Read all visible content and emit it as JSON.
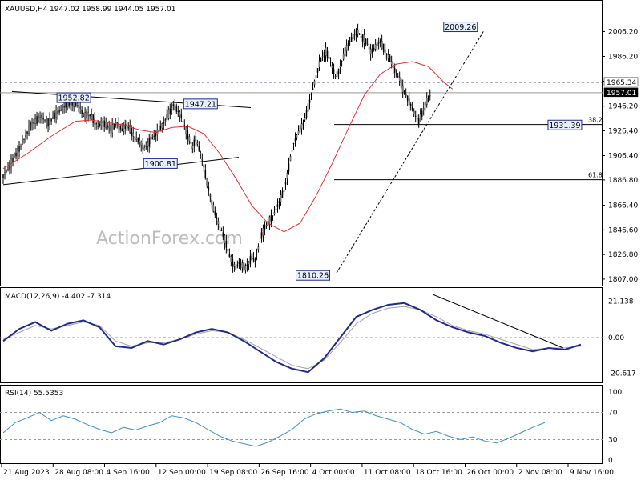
{
  "header": {
    "symbol": "XAUUSD,H4",
    "ohlc": "1947.02 1958.99 1944.05 1957.01"
  },
  "watermark": "ActionForex.com",
  "colors": {
    "candle": "#000000",
    "ma": "#e03030",
    "macd": "#1f2a8c",
    "signal": "#a0a0a0",
    "rsi": "#3a8fd0",
    "label_bg": "#e8f0ff",
    "label_border": "#1f2a8c",
    "current_price_bg": "#000000"
  },
  "chart_data": [
    {
      "type": "candlestick",
      "panel": "price",
      "title": "XAUUSD,H4",
      "ylim": [
        1805,
        2020
      ],
      "y_ticks": [
        2006.2,
        1986.2,
        1966.2,
        1946.2,
        1926.4,
        1906.4,
        1886.8,
        1866.4,
        1846.6,
        1826.8,
        1807.0
      ],
      "y_tick_labels": [
        "2006.20",
        "1986.20",
        "",
        "1946.20",
        "1926.40",
        "1906.40",
        "1886.80",
        "1866.40",
        "1846.60",
        "1826.80",
        "1807.00"
      ],
      "x_labels": [
        "21 Aug 2023",
        "28 Aug 08:00",
        "4 Sep 16:00",
        "12 Sep 00:00",
        "19 Sep 08:00",
        "26 Sep 16:00",
        "4 Oct 00:00",
        "11 Oct 08:00",
        "18 Oct 16:00",
        "26 Oct 00:00",
        "2 Nov 08:00",
        "9 Nov 16:00"
      ],
      "close_path": [
        [
          0,
          1890
        ],
        [
          8,
          1898
        ],
        [
          14,
          1905
        ],
        [
          22,
          1914
        ],
        [
          28,
          1922
        ],
        [
          34,
          1930
        ],
        [
          40,
          1934
        ],
        [
          48,
          1938
        ],
        [
          54,
          1932
        ],
        [
          60,
          1935
        ],
        [
          66,
          1940
        ],
        [
          72,
          1943
        ],
        [
          78,
          1947
        ],
        [
          84,
          1948
        ],
        [
          90,
          1949
        ],
        [
          96,
          1945
        ],
        [
          100,
          1938
        ],
        [
          106,
          1940
        ],
        [
          112,
          1936
        ],
        [
          118,
          1930
        ],
        [
          124,
          1933
        ],
        [
          130,
          1930
        ],
        [
          136,
          1928
        ],
        [
          142,
          1933
        ],
        [
          148,
          1927
        ],
        [
          154,
          1931
        ],
        [
          158,
          1928
        ],
        [
          164,
          1921
        ],
        [
          170,
          1918
        ],
        [
          176,
          1912
        ],
        [
          182,
          1917
        ],
        [
          188,
          1922
        ],
        [
          196,
          1928
        ],
        [
          202,
          1935
        ],
        [
          208,
          1942
        ],
        [
          212,
          1947
        ],
        [
          216,
          1944
        ],
        [
          222,
          1938
        ],
        [
          226,
          1930
        ],
        [
          232,
          1920
        ],
        [
          236,
          1913
        ],
        [
          240,
          1920
        ],
        [
          246,
          1908
        ],
        [
          250,
          1898
        ],
        [
          254,
          1885
        ],
        [
          258,
          1874
        ],
        [
          262,
          1864
        ],
        [
          266,
          1856
        ],
        [
          270,
          1849
        ],
        [
          274,
          1843
        ],
        [
          278,
          1835
        ],
        [
          282,
          1826
        ],
        [
          286,
          1820
        ],
        [
          290,
          1816
        ],
        [
          294,
          1820
        ],
        [
          298,
          1818
        ],
        [
          302,
          1816
        ],
        [
          306,
          1820
        ],
        [
          310,
          1825
        ],
        [
          314,
          1822
        ],
        [
          318,
          1832
        ],
        [
          322,
          1842
        ],
        [
          326,
          1848
        ],
        [
          330,
          1852
        ],
        [
          334,
          1856
        ],
        [
          338,
          1860
        ],
        [
          342,
          1866
        ],
        [
          346,
          1872
        ],
        [
          350,
          1878
        ],
        [
          354,
          1890
        ],
        [
          358,
          1904
        ],
        [
          362,
          1916
        ],
        [
          366,
          1922
        ],
        [
          370,
          1928
        ],
        [
          374,
          1932
        ],
        [
          378,
          1940
        ],
        [
          382,
          1950
        ],
        [
          386,
          1960
        ],
        [
          390,
          1970
        ],
        [
          394,
          1980
        ],
        [
          398,
          1986
        ],
        [
          402,
          1990
        ],
        [
          406,
          1985
        ],
        [
          410,
          1978
        ],
        [
          414,
          1970
        ],
        [
          418,
          1974
        ],
        [
          422,
          1982
        ],
        [
          426,
          1990
        ],
        [
          430,
          1996
        ],
        [
          434,
          2000
        ],
        [
          438,
          2004
        ],
        [
          442,
          2006
        ],
        [
          446,
          2002
        ],
        [
          450,
          2000
        ],
        [
          454,
          1996
        ],
        [
          458,
          1990
        ],
        [
          462,
          1992
        ],
        [
          466,
          1996
        ],
        [
          470,
          1998
        ],
        [
          474,
          1993
        ],
        [
          478,
          1988
        ],
        [
          482,
          1984
        ],
        [
          486,
          1978
        ],
        [
          490,
          1972
        ],
        [
          494,
          1968
        ],
        [
          498,
          1960
        ],
        [
          502,
          1955
        ],
        [
          506,
          1950
        ],
        [
          510,
          1944
        ],
        [
          514,
          1938
        ],
        [
          518,
          1934
        ],
        [
          522,
          1940
        ],
        [
          526,
          1948
        ],
        [
          530,
          1952
        ],
        [
          534,
          1957
        ]
      ],
      "ma_path": [
        [
          0,
          1896
        ],
        [
          30,
          1908
        ],
        [
          60,
          1922
        ],
        [
          90,
          1934
        ],
        [
          110,
          1935
        ],
        [
          130,
          1933
        ],
        [
          150,
          1931
        ],
        [
          170,
          1927
        ],
        [
          190,
          1925
        ],
        [
          210,
          1929
        ],
        [
          230,
          1930
        ],
        [
          250,
          1924
        ],
        [
          270,
          1908
        ],
        [
          290,
          1888
        ],
        [
          310,
          1866
        ],
        [
          330,
          1852
        ],
        [
          350,
          1845
        ],
        [
          370,
          1852
        ],
        [
          390,
          1874
        ],
        [
          410,
          1900
        ],
        [
          430,
          1928
        ],
        [
          450,
          1955
        ],
        [
          470,
          1972
        ],
        [
          490,
          1980
        ],
        [
          510,
          1982
        ],
        [
          530,
          1978
        ],
        [
          550,
          1965
        ],
        [
          560,
          1960
        ]
      ],
      "annotations": [
        {
          "label": "1952.82"
        },
        {
          "label": "1947.21"
        },
        {
          "label": "1900.81"
        },
        {
          "label": "1810.26"
        },
        {
          "label": "2009.26"
        },
        {
          "label": "1931.39"
        }
      ],
      "price_level_labels": {
        "upper_dashed": "1965.34",
        "current": "1957.01",
        "fib_38": "38.2",
        "fib_61": "61.8"
      }
    },
    {
      "type": "line",
      "panel": "macd",
      "title": "MACD(12,26,9) -4.402 -7.314",
      "ylim": [
        -25,
        25
      ],
      "y_tick_labels": [
        "21.138",
        "0.00",
        "-20.617"
      ],
      "macd_path": [
        [
          0,
          -2
        ],
        [
          20,
          5
        ],
        [
          40,
          9
        ],
        [
          60,
          4
        ],
        [
          80,
          8
        ],
        [
          100,
          10
        ],
        [
          120,
          6
        ],
        [
          140,
          -5
        ],
        [
          160,
          -6
        ],
        [
          180,
          -2
        ],
        [
          200,
          -4
        ],
        [
          220,
          -1
        ],
        [
          240,
          3
        ],
        [
          260,
          5
        ],
        [
          280,
          3
        ],
        [
          300,
          -2
        ],
        [
          320,
          -8
        ],
        [
          340,
          -14
        ],
        [
          360,
          -18
        ],
        [
          380,
          -20
        ],
        [
          400,
          -12
        ],
        [
          420,
          0
        ],
        [
          440,
          12
        ],
        [
          460,
          16
        ],
        [
          480,
          19
        ],
        [
          500,
          20
        ],
        [
          520,
          16
        ],
        [
          540,
          10
        ],
        [
          560,
          6
        ],
        [
          580,
          3
        ],
        [
          600,
          1
        ],
        [
          620,
          -3
        ],
        [
          640,
          -6
        ],
        [
          660,
          -8
        ],
        [
          680,
          -6
        ],
        [
          700,
          -7
        ],
        [
          720,
          -4
        ]
      ],
      "signal_path": [
        [
          0,
          -1
        ],
        [
          20,
          3
        ],
        [
          40,
          7
        ],
        [
          60,
          5
        ],
        [
          80,
          7
        ],
        [
          100,
          9
        ],
        [
          120,
          7
        ],
        [
          140,
          -2
        ],
        [
          160,
          -5
        ],
        [
          180,
          -3
        ],
        [
          200,
          -3
        ],
        [
          220,
          -1
        ],
        [
          240,
          2
        ],
        [
          260,
          4
        ],
        [
          280,
          3
        ],
        [
          300,
          -1
        ],
        [
          320,
          -6
        ],
        [
          340,
          -11
        ],
        [
          360,
          -16
        ],
        [
          380,
          -18
        ],
        [
          400,
          -13
        ],
        [
          420,
          -3
        ],
        [
          440,
          8
        ],
        [
          460,
          14
        ],
        [
          480,
          17
        ],
        [
          500,
          18
        ],
        [
          520,
          16
        ],
        [
          540,
          12
        ],
        [
          560,
          7
        ],
        [
          580,
          4
        ],
        [
          600,
          2
        ],
        [
          620,
          -1
        ],
        [
          640,
          -4
        ],
        [
          660,
          -7
        ],
        [
          680,
          -6
        ],
        [
          700,
          -6
        ],
        [
          720,
          -5
        ]
      ]
    },
    {
      "type": "line",
      "panel": "rsi",
      "title": "RSI(14) 55.5353",
      "ylim": [
        0,
        100
      ],
      "y_tick_labels": [
        "100",
        "70",
        "30",
        "0"
      ],
      "rsi_path": [
        [
          0,
          40
        ],
        [
          15,
          55
        ],
        [
          30,
          62
        ],
        [
          45,
          70
        ],
        [
          60,
          58
        ],
        [
          75,
          65
        ],
        [
          90,
          60
        ],
        [
          105,
          52
        ],
        [
          120,
          45
        ],
        [
          135,
          40
        ],
        [
          150,
          48
        ],
        [
          165,
          44
        ],
        [
          180,
          50
        ],
        [
          195,
          55
        ],
        [
          210,
          65
        ],
        [
          225,
          62
        ],
        [
          240,
          55
        ],
        [
          255,
          45
        ],
        [
          270,
          35
        ],
        [
          285,
          28
        ],
        [
          300,
          24
        ],
        [
          315,
          20
        ],
        [
          330,
          26
        ],
        [
          345,
          35
        ],
        [
          360,
          45
        ],
        [
          375,
          60
        ],
        [
          390,
          68
        ],
        [
          405,
          72
        ],
        [
          420,
          75
        ],
        [
          435,
          70
        ],
        [
          450,
          72
        ],
        [
          465,
          65
        ],
        [
          480,
          60
        ],
        [
          495,
          55
        ],
        [
          510,
          45
        ],
        [
          525,
          38
        ],
        [
          540,
          42
        ],
        [
          555,
          35
        ],
        [
          570,
          30
        ],
        [
          585,
          34
        ],
        [
          600,
          28
        ],
        [
          615,
          25
        ],
        [
          630,
          32
        ],
        [
          645,
          40
        ],
        [
          660,
          48
        ],
        [
          675,
          55
        ]
      ]
    }
  ]
}
